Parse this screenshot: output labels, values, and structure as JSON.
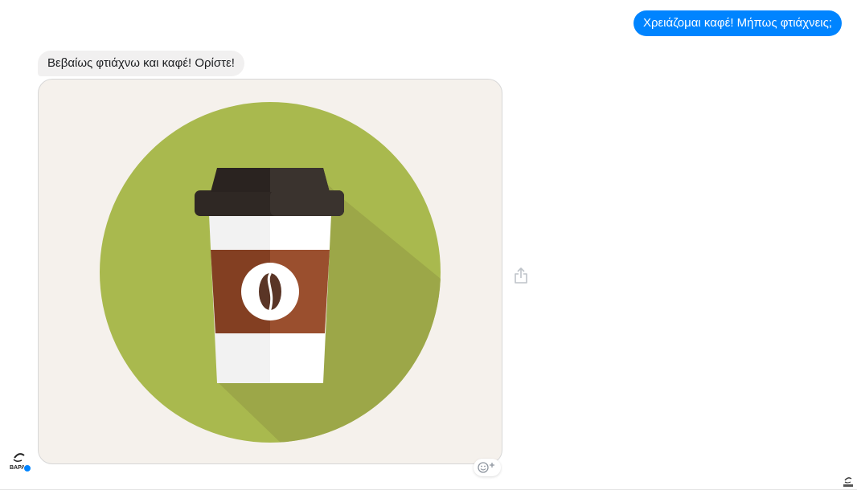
{
  "conversation": {
    "messages": [
      {
        "sender": "user",
        "text": "Χρειάζομαι καφέ! Μήπως φτιάχνεις;"
      },
      {
        "sender": "bot",
        "text": "Βεβαίως φτιάχνω και καφέ! Ορίστε!"
      }
    ],
    "image": {
      "icon": "coffee-cup-icon",
      "colors": {
        "background": "#f5f1ec",
        "circle": "#a9b94e",
        "shadow": "#94a046",
        "lid": "#2f2824",
        "cup": "#f0f0f0",
        "sleeve": "#8c4a2a",
        "bean": "#5a3526"
      }
    }
  },
  "actions": {
    "share_icon": "share-icon",
    "react_icon": "add-reaction-icon"
  },
  "avatar": {
    "icon": "bot-avatar-logo",
    "logo_text": "ΒΑΡΑ",
    "badge_color": "#0084ff"
  },
  "theme": {
    "accent": "#0084ff",
    "incoming_bubble": "#f1f0f0"
  }
}
